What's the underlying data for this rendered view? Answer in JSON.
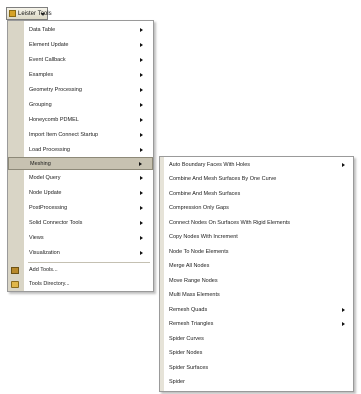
{
  "toolbar": {
    "button_label": "Leister Tools"
  },
  "main_menu": {
    "items": [
      {
        "label": "Data Table",
        "submenu": true
      },
      {
        "label": "Element Update",
        "submenu": true
      },
      {
        "label": "Event Callback",
        "submenu": true
      },
      {
        "label": "Examples",
        "submenu": true
      },
      {
        "label": "Geometry Processing",
        "submenu": true
      },
      {
        "label": "Grouping",
        "submenu": true
      },
      {
        "label": "Honeycomb PDMEL",
        "submenu": true
      },
      {
        "label": "Import Item Connect Startup",
        "submenu": true
      },
      {
        "label": "Load Processing",
        "submenu": true
      },
      {
        "label": "Meshing",
        "submenu": true,
        "active": true
      },
      {
        "label": "Model Query",
        "submenu": true
      },
      {
        "label": "Node Update",
        "submenu": true
      },
      {
        "label": "PostProcessing",
        "submenu": true
      },
      {
        "label": "Solid Connector Tools",
        "submenu": true
      },
      {
        "label": "Views",
        "submenu": true
      },
      {
        "label": "Visualization",
        "submenu": true
      }
    ],
    "footer_items": [
      {
        "label": "Add Tools...",
        "icon": "tools-icon"
      },
      {
        "label": "Tools Directory...",
        "icon": "folder-icon"
      }
    ]
  },
  "submenu": {
    "items": [
      {
        "label": "Auto Boundary Faces With Holes",
        "submenu": true
      },
      {
        "label": "Combine And Mesh Surfaces By One Curve",
        "submenu": false
      },
      {
        "label": "Combine And Mesh Surfaces",
        "submenu": false
      },
      {
        "label": "Compression Only Gaps",
        "submenu": false
      },
      {
        "label": "Connect Nodes On Surfaces With Rigid Elements",
        "submenu": false
      },
      {
        "label": "Copy Nodes With Increment",
        "submenu": false
      },
      {
        "label": "Node To Node Elements",
        "submenu": false
      },
      {
        "label": "Merge All Nodes",
        "submenu": false
      },
      {
        "label": "Move Range Nodes",
        "submenu": false
      },
      {
        "label": "Multi Mass Elements",
        "submenu": false
      },
      {
        "label": "Remesh Quads",
        "submenu": true
      },
      {
        "label": "Remesh Triangles",
        "submenu": true
      },
      {
        "label": "Spider Curves",
        "submenu": false
      },
      {
        "label": "Spider Nodes",
        "submenu": false
      },
      {
        "label": "Spider Surfaces",
        "submenu": false
      },
      {
        "label": "Spider",
        "submenu": false
      }
    ]
  },
  "colors": {
    "gutter": "#d9d5c6",
    "highlight": "#c7c2b1",
    "border": "#9a9a9a"
  }
}
